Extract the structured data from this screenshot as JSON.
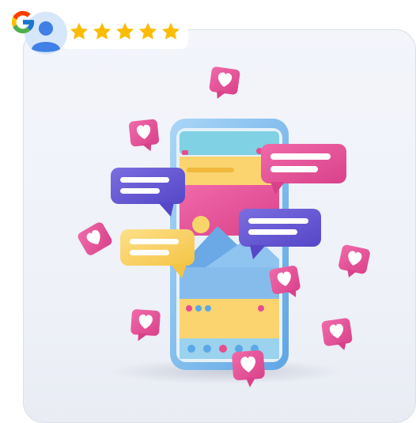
{
  "review_badge": {
    "provider_icon": "google-g-icon",
    "avatar_icon": "user-avatar-icon",
    "rating": 5,
    "rating_max": 5,
    "star_color": "#fbbc04"
  },
  "illustration": {
    "subject": "social-media-phone-illustration",
    "colors": {
      "phone_frame": "#8ec5ef",
      "screen_pink": "#ea4f9a",
      "screen_yellow": "#fbd470",
      "screen_blue": "#6aa9e6",
      "bubble_purple": "#6b5fd6",
      "bubble_pink": "#e85a9c",
      "bubble_yellow": "#f7cf5b",
      "heart_bubble": "#e34d8b"
    }
  }
}
